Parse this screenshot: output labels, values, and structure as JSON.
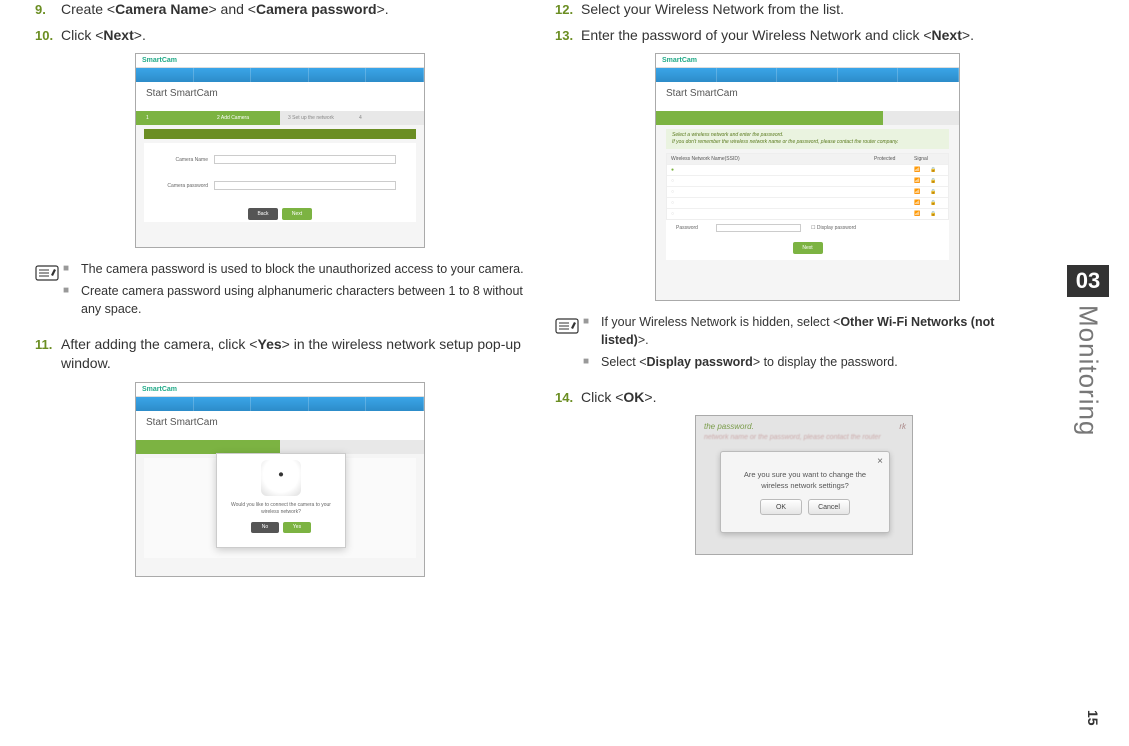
{
  "left": {
    "step9": {
      "num": "9.",
      "pre": "Create <",
      "b1": "Camera Name",
      "mid": "> and <",
      "b2": "Camera password",
      "post": ">."
    },
    "step10": {
      "num": "10.",
      "pre": "Click <",
      "b1": "Next",
      "post": ">."
    },
    "note1": "The camera password is used to block the unauthorized access to your camera.",
    "note2": "Create camera password using alphanumeric characters between 1 to 8 without any space.",
    "step11": {
      "num": "11.",
      "pre": "After adding the camera, click <",
      "b1": "Yes",
      "post": "> in the wireless network setup pop-up window."
    }
  },
  "right": {
    "step12": {
      "num": "12.",
      "text": "Select your Wireless Network from the list."
    },
    "step13": {
      "num": "13.",
      "pre": "Enter the password of your Wireless Network and click <",
      "b1": "Next",
      "post": ">."
    },
    "note1": {
      "pre": "If your Wireless Network is hidden, select <",
      "b1": "Other Wi-Fi Networks (not listed)",
      "post": ">."
    },
    "note2": {
      "pre": "Select <",
      "b1": "Display password",
      "post": "> to display the password."
    },
    "step14": {
      "num": "14.",
      "pre": "Click <",
      "b1": "OK",
      "post": ">."
    }
  },
  "mini": {
    "logo_a": "Smart",
    "logo_b": "Cam",
    "title": "Start SmartCam",
    "add_camera": "Add Camera",
    "setup_net": "Set up the network",
    "camera_name": "Camera Name",
    "camera_password": "Camera password",
    "back": "Back",
    "next": "Next",
    "yes": "Yes",
    "no": "No",
    "password": "Password",
    "display_password": "Display password"
  },
  "dialog": {
    "msg": "Are you sure you want to change the wireless network settings?",
    "ok": "OK",
    "cancel": "Cancel",
    "blur1": "the password.",
    "blur2_suffix": "rk"
  },
  "sidebar": {
    "chapter": "03",
    "title": "Monitoring",
    "page": "15"
  }
}
